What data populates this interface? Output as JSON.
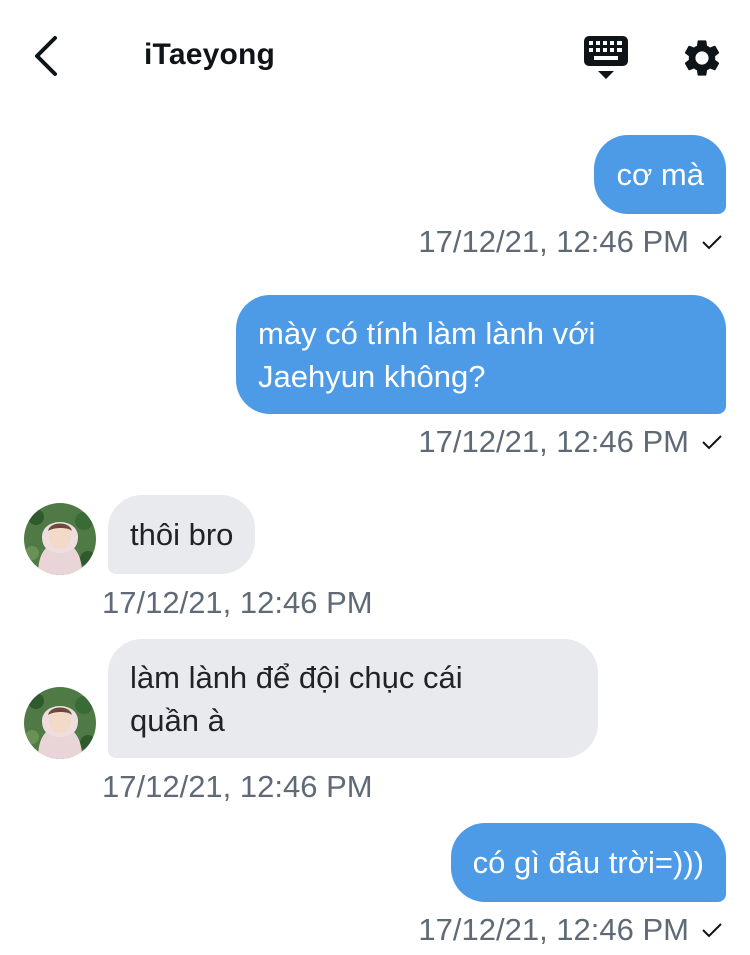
{
  "header": {
    "title": "iTaeyong",
    "back_icon": "chevron-left-icon",
    "keyboard_icon": "keyboard-icon",
    "settings_icon": "gear-icon"
  },
  "colors": {
    "outgoing_bubble": "#4d9be6",
    "incoming_bubble": "#e8eaee",
    "timestamp": "#5f6a76"
  },
  "messages": [
    {
      "direction": "out",
      "text": "cơ mà",
      "timestamp": "17/12/21, 12:46 PM",
      "read": true
    },
    {
      "direction": "out",
      "text": "mày có tính làm lành với\nJaehyun không?",
      "timestamp": "17/12/21, 12:46 PM",
      "read": true
    },
    {
      "direction": "in",
      "text": "thôi bro",
      "timestamp": "17/12/21, 12:46 PM"
    },
    {
      "direction": "in",
      "text": "làm lành để đội chục cái\nquần à",
      "timestamp": "17/12/21, 12:46 PM"
    },
    {
      "direction": "out",
      "text": "có gì đâu trời=)))",
      "timestamp": "17/12/21, 12:46 PM",
      "read": true
    }
  ]
}
